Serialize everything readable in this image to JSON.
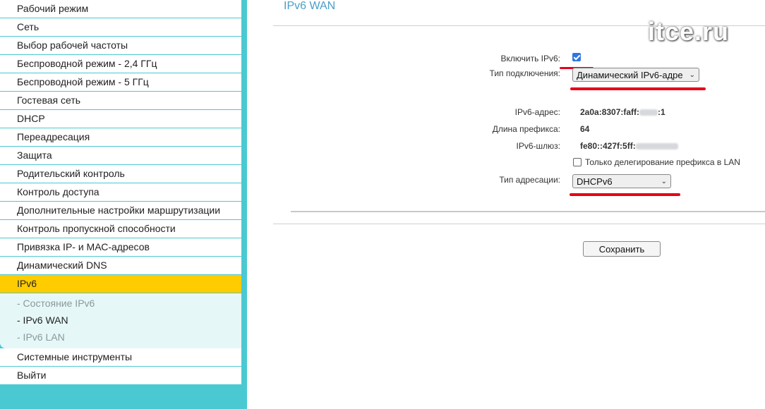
{
  "sidebar": {
    "items_before": [
      "Рабочий режим",
      "Сеть",
      "Выбор рабочей частоты",
      "Беспроводной режим - 2,4 ГГц",
      "Беспроводной режим - 5 ГГц",
      "Гостевая сеть",
      "DHCP",
      "Переадресация",
      "Защита",
      "Родительский контроль",
      "Контроль доступа",
      "Дополнительные настройки маршрутизации",
      "Контроль пропускной способности",
      "Привязка IP- и МАС-адресов",
      "Динамический DNS"
    ],
    "active": "IPv6",
    "subitems": [
      "- Состояние IPv6",
      "- IPv6 WAN",
      "- IPv6 LAN"
    ],
    "items_after": [
      "Системные инструменты",
      "Выйти"
    ]
  },
  "main": {
    "title": "IPv6 WAN",
    "watermark": "itce.ru",
    "enable_label": "Включить IPv6:",
    "enable_checked": true,
    "conn_type_label": "Тип подключения:",
    "conn_type_value": "Динамический IPv6-адре",
    "ipv6_addr_label": "IPv6-адрес:",
    "ipv6_addr_prefix": "2a0a:8307:faff:",
    "ipv6_addr_suffix": ":1",
    "prefix_len_label": "Длина префикса:",
    "prefix_len_value": "64",
    "gateway_label": "IPv6-шлюз:",
    "gateway_value": "fe80::427f:5ff:",
    "prefix_only_label": "Только делегирование префикса в LAN",
    "prefix_only_checked": false,
    "addr_type_label": "Тип адресации:",
    "addr_type_value": "DHCPv6",
    "save_label": "Сохранить"
  },
  "colors": {
    "sidebar_bg": "#4ac9d2",
    "active_item": "#ffcc00",
    "title": "#4a9fc8",
    "annotation_red": "#e8001c"
  }
}
